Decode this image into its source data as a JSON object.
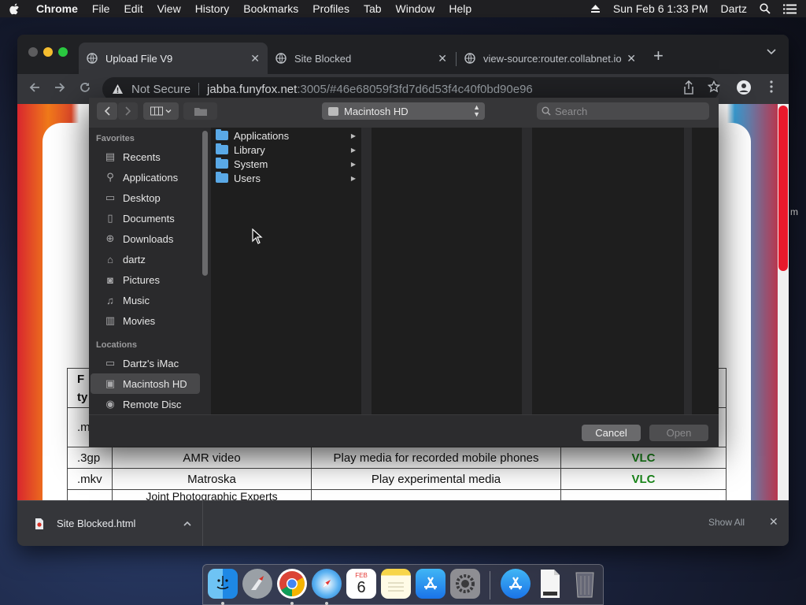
{
  "menubar": {
    "app": "Chrome",
    "items": [
      "File",
      "Edit",
      "View",
      "History",
      "Bookmarks",
      "Profiles",
      "Tab",
      "Window",
      "Help"
    ],
    "clock": "Sun Feb 6  1:33 PM",
    "user": "Dartz"
  },
  "tabs": [
    {
      "title": "Upload File V9",
      "active": true
    },
    {
      "title": "Site Blocked",
      "active": false
    },
    {
      "title": "view-source:router.collabnet.io",
      "active": false
    }
  ],
  "address": {
    "security": "Not Secure",
    "host": "jabba.funyfox.net",
    "rest": ":3005/#46e68059f3fd7d6d53f4c40f0bd90e96"
  },
  "page_table": {
    "partial_header": [
      "F",
      "ty"
    ],
    "partial_cell": ".m",
    "rows": [
      {
        "ext": ".3gp",
        "format": "AMR video",
        "use": "Play media for recorded mobile phones",
        "app": "VLC"
      },
      {
        "ext": ".mkv",
        "format": "Matroska",
        "use": "Play experimental media",
        "app": "VLC"
      }
    ],
    "cut_row_text": "Joint Photographic Experts"
  },
  "dialog": {
    "location": "Macintosh HD",
    "search_placeholder": "Search",
    "favorites_label": "Favorites",
    "favorites": [
      {
        "label": "Recents",
        "icon": "recents-icon"
      },
      {
        "label": "Applications",
        "icon": "applications-icon"
      },
      {
        "label": "Desktop",
        "icon": "desktop-icon"
      },
      {
        "label": "Documents",
        "icon": "documents-icon"
      },
      {
        "label": "Downloads",
        "icon": "downloads-icon"
      },
      {
        "label": "dartz",
        "icon": "home-icon"
      },
      {
        "label": "Pictures",
        "icon": "pictures-icon"
      },
      {
        "label": "Music",
        "icon": "music-icon"
      },
      {
        "label": "Movies",
        "icon": "movies-icon"
      }
    ],
    "locations_label": "Locations",
    "locations": [
      {
        "label": "Dartz's iMac",
        "icon": "imac-icon"
      },
      {
        "label": "Macintosh HD",
        "icon": "hard-disk-icon",
        "selected": true
      },
      {
        "label": "Remote Disc",
        "icon": "remote-disc-icon"
      }
    ],
    "folders": [
      "Applications",
      "Library",
      "System",
      "Users"
    ],
    "cancel": "Cancel",
    "open": "Open"
  },
  "download": {
    "file": "Site Blocked.html",
    "show_all": "Show All"
  },
  "dock": {
    "calendar_month": "FEB",
    "calendar_day": "6",
    "apps": [
      "Finder",
      "Launchpad",
      "Google Chrome",
      "Safari",
      "Calendar",
      "Notes",
      "App Store",
      "System Preferences",
      "App Store Downloads",
      "HTML Document",
      "Trash"
    ]
  },
  "colors": {
    "accent_red": "#e8192c",
    "vlc_green": "#1a8a1a",
    "folder_blue": "#5aa9e6"
  }
}
